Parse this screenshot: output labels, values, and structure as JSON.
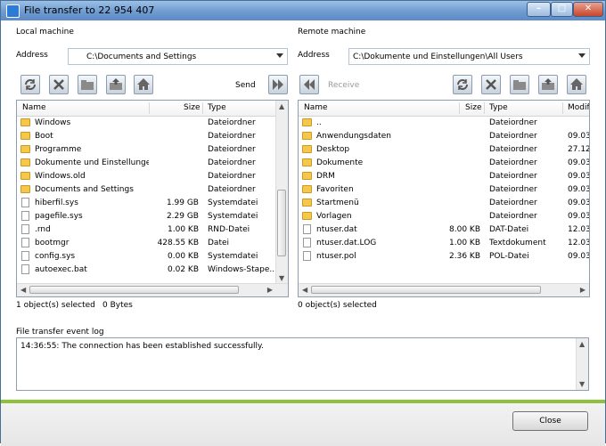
{
  "window": {
    "title": "File transfer to 22 954 407",
    "min": "–",
    "max": "□",
    "close": "✕"
  },
  "local": {
    "heading": "Local machine",
    "address_label": "Address",
    "address_value": "C:\\Documents and Settings",
    "send_label": "Send",
    "columns": [
      "Name",
      "Size",
      "Type"
    ],
    "rows": [
      {
        "name": "Windows",
        "size": "",
        "type": "Dateiordner",
        "icon": "folder"
      },
      {
        "name": "Boot",
        "size": "",
        "type": "Dateiordner",
        "icon": "folder"
      },
      {
        "name": "Programme",
        "size": "",
        "type": "Dateiordner",
        "icon": "folder"
      },
      {
        "name": "Dokumente und Einstellungen",
        "size": "",
        "type": "Dateiordner",
        "icon": "folder"
      },
      {
        "name": "Windows.old",
        "size": "",
        "type": "Dateiordner",
        "icon": "folder"
      },
      {
        "name": "Documents and Settings",
        "size": "",
        "type": "Dateiordner",
        "icon": "folder"
      },
      {
        "name": "hiberfil.sys",
        "size": "1.99 GB",
        "type": "Systemdatei",
        "icon": "file"
      },
      {
        "name": "pagefile.sys",
        "size": "2.29 GB",
        "type": "Systemdatei",
        "icon": "file"
      },
      {
        "name": ".rnd",
        "size": "1.00 KB",
        "type": "RND-Datei",
        "icon": "file"
      },
      {
        "name": "bootmgr",
        "size": "428.55 KB",
        "type": "Datei",
        "icon": "file"
      },
      {
        "name": "config.sys",
        "size": "0.00 KB",
        "type": "Systemdatei",
        "icon": "file"
      },
      {
        "name": "autoexec.bat",
        "size": "0.02 KB",
        "type": "Windows-Stape...",
        "icon": "file"
      }
    ],
    "status_selected": "1 object(s) selected",
    "status_bytes": "0 Bytes"
  },
  "remote": {
    "heading": "Remote machine",
    "address_label": "Address",
    "address_value": "C:\\Dokumente und Einstellungen\\All Users",
    "receive_label": "Receive",
    "columns": [
      "Name",
      "Size",
      "Type",
      "Modif"
    ],
    "rows": [
      {
        "name": "..",
        "size": "",
        "type": "Dateiordner",
        "mod": "",
        "icon": "folder"
      },
      {
        "name": "Anwendungsdaten",
        "size": "",
        "type": "Dateiordner",
        "mod": "09.03",
        "icon": "folder"
      },
      {
        "name": "Desktop",
        "size": "",
        "type": "Dateiordner",
        "mod": "27.12",
        "icon": "folder"
      },
      {
        "name": "Dokumente",
        "size": "",
        "type": "Dateiordner",
        "mod": "09.03",
        "icon": "folder"
      },
      {
        "name": "DRM",
        "size": "",
        "type": "Dateiordner",
        "mod": "09.03",
        "icon": "folder"
      },
      {
        "name": "Favoriten",
        "size": "",
        "type": "Dateiordner",
        "mod": "09.03",
        "icon": "folder"
      },
      {
        "name": "Startmenü",
        "size": "",
        "type": "Dateiordner",
        "mod": "09.03",
        "icon": "folder"
      },
      {
        "name": "Vorlagen",
        "size": "",
        "type": "Dateiordner",
        "mod": "09.03",
        "icon": "folder"
      },
      {
        "name": "ntuser.dat",
        "size": "8.00 KB",
        "type": "DAT-Datei",
        "mod": "12.03",
        "icon": "file"
      },
      {
        "name": "ntuser.dat.LOG",
        "size": "1.00 KB",
        "type": "Textdokument",
        "mod": "12.03",
        "icon": "file"
      },
      {
        "name": "ntuser.pol",
        "size": "2.36 KB",
        "type": "POL-Datei",
        "mod": "09.03",
        "icon": "file"
      }
    ],
    "status_selected": "0 object(s) selected"
  },
  "log": {
    "label": "File transfer event log",
    "entries": [
      "14:36:55: The connection has been established successfully."
    ]
  },
  "footer": {
    "close_label": "Close"
  },
  "colors": {
    "accent_green": "#8cc23c",
    "folder": "#f5c84c",
    "titlebar": "#6f9bd0"
  },
  "icons": [
    "refresh-icon",
    "delete-icon",
    "new-folder-icon",
    "folder-up-icon",
    "home-icon",
    "send-arrow-icon",
    "receive-arrow-icon"
  ]
}
